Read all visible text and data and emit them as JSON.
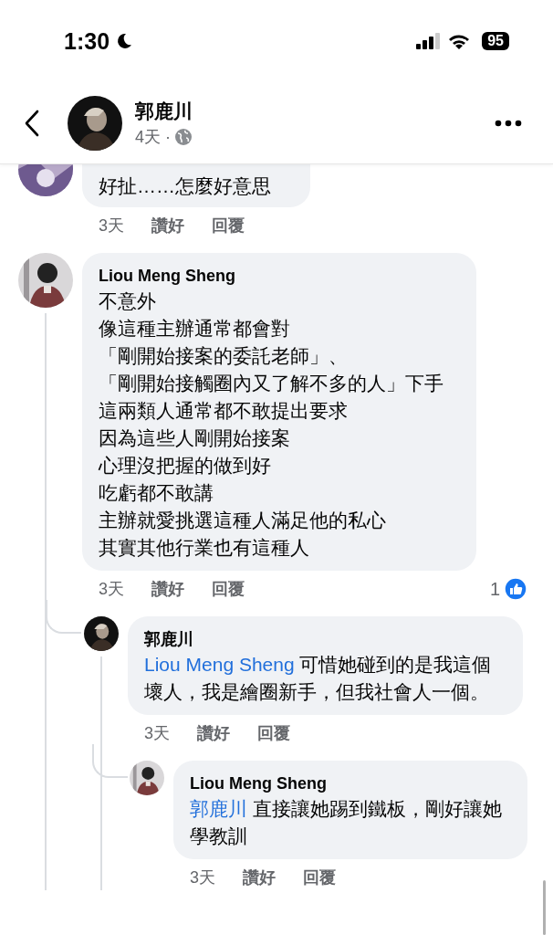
{
  "status_bar": {
    "time": "1:30",
    "battery": "95"
  },
  "header": {
    "name": "郭鹿川",
    "meta": "4天 ·"
  },
  "comments": [
    {
      "lines": [
        "好扯……怎麼好意思"
      ],
      "time": "3天",
      "like": "讚好",
      "reply": "回覆"
    },
    {
      "author": "Liou Meng Sheng",
      "lines": [
        "不意外",
        "像這種主辦通常都會對",
        "「剛開始接案的委託老師」、",
        "「剛開始接觸圈內又了解不多的人」下手",
        "這兩類人通常都不敢提出要求",
        "因為這些人剛開始接案",
        "心理沒把握的做到好",
        "吃虧都不敢講",
        "主辦就愛挑選這種人滿足他的私心",
        "其實其他行業也有這種人"
      ],
      "time": "3天",
      "like": "讚好",
      "reply": "回覆",
      "reactions": "1",
      "replies": [
        {
          "author": "郭鹿川",
          "mention": "Liou Meng Sheng",
          "lines": [
            "可惜她碰到的是我這個壞人，我是繪圈新手，但我社會人一個。"
          ],
          "time": "3天",
          "like": "讚好",
          "reply": "回覆",
          "replies": [
            {
              "author": "Liou Meng Sheng",
              "mention": "郭鹿川",
              "lines": [
                "直接讓她踢到鐵板，剛好讓她學教訓"
              ],
              "time": "3天",
              "like": "讚好",
              "reply": "回覆"
            }
          ]
        }
      ]
    }
  ]
}
